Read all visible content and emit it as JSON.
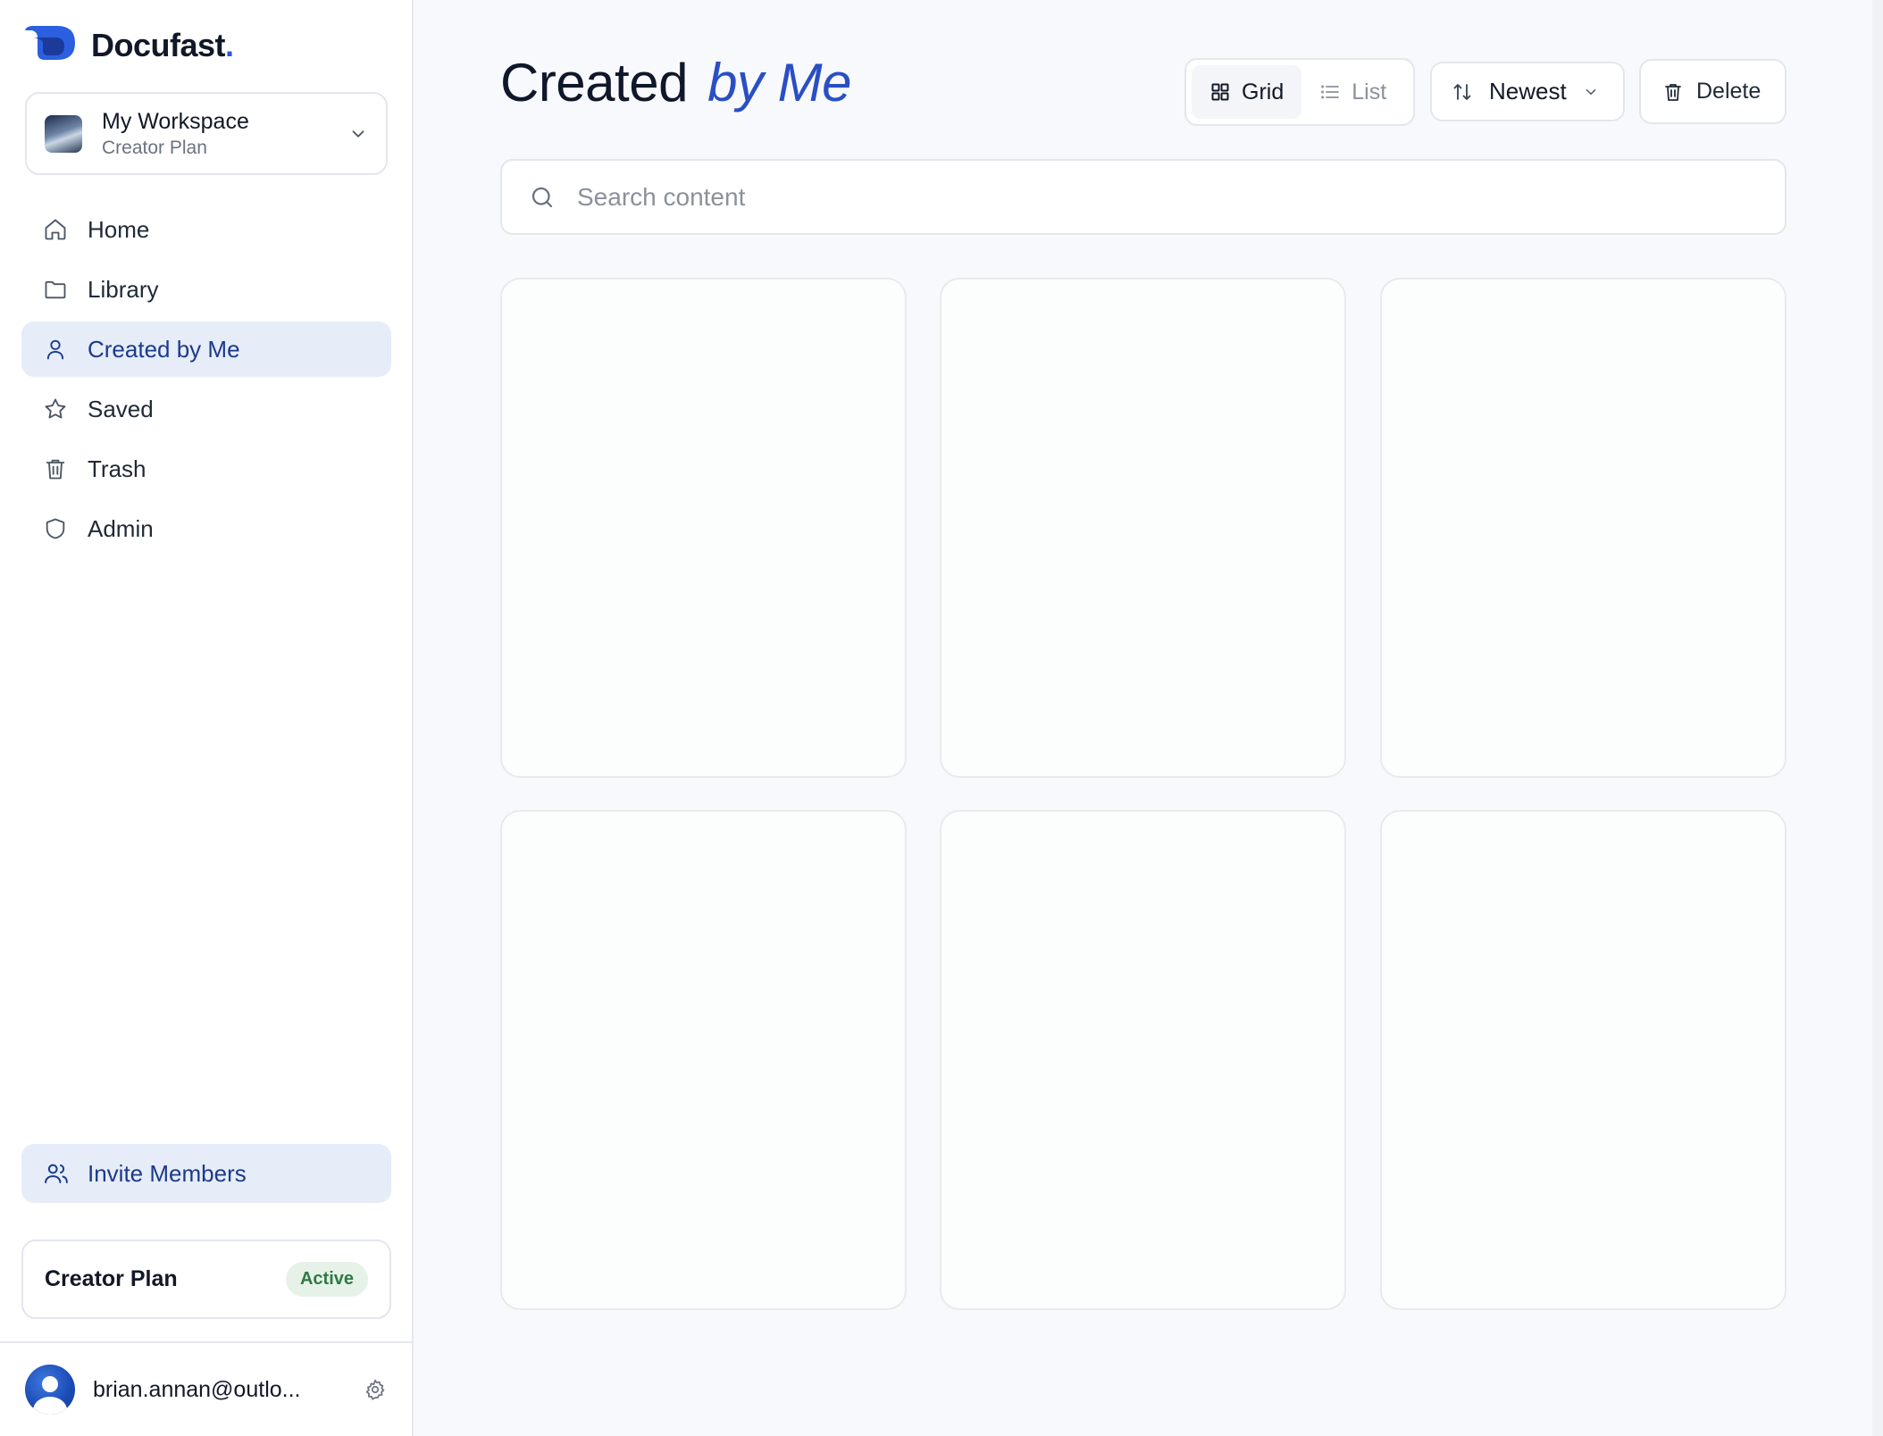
{
  "brand": {
    "name": "Docufast",
    "dot": "."
  },
  "workspace": {
    "name": "My Workspace",
    "plan": "Creator Plan"
  },
  "nav": {
    "items": [
      {
        "label": "Home",
        "icon": "home-icon"
      },
      {
        "label": "Library",
        "icon": "folder-icon"
      },
      {
        "label": "Created by Me",
        "icon": "user-icon",
        "active": true
      },
      {
        "label": "Saved",
        "icon": "star-icon"
      },
      {
        "label": "Trash",
        "icon": "trash-icon"
      },
      {
        "label": "Admin",
        "icon": "shield-icon"
      }
    ]
  },
  "invite": {
    "label": "Invite Members",
    "icon": "users-icon"
  },
  "plan_card": {
    "name": "Creator Plan",
    "status": "Active"
  },
  "user": {
    "email": "brian.annan@outlo..."
  },
  "header": {
    "title_main": "Created",
    "title_accent": "by Me"
  },
  "toolbar": {
    "grid_label": "Grid",
    "list_label": "List",
    "sort_label": "Newest",
    "delete_label": "Delete"
  },
  "search": {
    "placeholder": "Search content",
    "value": ""
  },
  "colors": {
    "accent": "#2a4fc4",
    "active_nav_bg": "#e6edf9",
    "badge_bg": "#e6f2e8",
    "badge_text": "#2f7a43"
  },
  "content": {
    "card_count": 6
  }
}
